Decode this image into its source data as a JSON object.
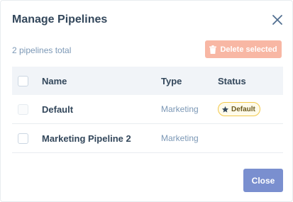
{
  "dialog": {
    "title": "Manage Pipelines",
    "close_icon": "close-icon"
  },
  "summary": {
    "count_text": "2 pipelines total"
  },
  "toolbar": {
    "delete_label": "Delete selected",
    "delete_icon": "trash-icon",
    "delete_enabled": false,
    "delete_color": "#f8b7a4"
  },
  "table": {
    "headers": {
      "name": "Name",
      "type": "Type",
      "status": "Status"
    },
    "rows": [
      {
        "name": "Default",
        "type": "Marketing",
        "status": "Default",
        "status_icon": "star-icon",
        "checkbox_enabled": false
      },
      {
        "name": "Marketing Pipeline 2",
        "type": "Marketing",
        "status": "",
        "checkbox_enabled": true
      }
    ]
  },
  "footer": {
    "close_label": "Close",
    "close_color": "#7a8fcf"
  }
}
